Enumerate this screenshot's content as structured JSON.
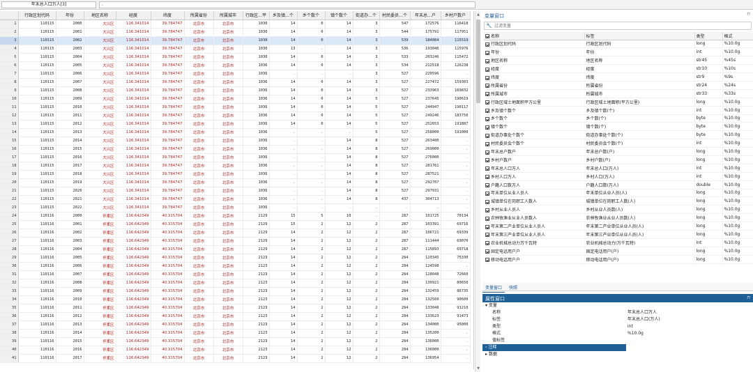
{
  "topbar": {
    "cell_ref": "年末总人口万人[3]",
    "cell_value": "."
  },
  "grid": {
    "columns": [
      "",
      "行政区划代码",
      "年份",
      "地区名称",
      "经度",
      "纬度",
      "所属省份",
      "所属城市",
      "行政区…平",
      "乡及镇…个",
      "乡个数个",
      "镇个数个",
      "街道办…个",
      "村民委员…个",
      "年末总…户",
      "乡村户数户"
    ],
    "rows": [
      [
        "1",
        "110115",
        "2000",
        "大兴区",
        "116.341014",
        "39.784747",
        "北京市",
        "北京市",
        "1030",
        "14",
        "0",
        "14",
        "3",
        "547",
        "172576",
        "116418"
      ],
      [
        "2",
        "110115",
        "2001",
        "大兴区",
        "116.341014",
        "39.784747",
        "北京市",
        "北京市",
        "1030",
        "14",
        "0",
        "14",
        "3",
        "544",
        "175791",
        "117951"
      ],
      [
        "3",
        "110115",
        "2002",
        "大兴区",
        "116.341014",
        "39.784747",
        "北京市",
        "北京市",
        "1030",
        "14",
        "0",
        "14",
        "3",
        "539",
        "184084",
        "115519"
      ],
      [
        "4",
        "110115",
        "2003",
        "大兴区",
        "116.341014",
        "39.784747",
        "北京市",
        "北京市",
        "1030",
        "13",
        ".",
        "14",
        "3",
        "536",
        "193040",
        "115976"
      ],
      [
        "5",
        "110115",
        "2004",
        "大兴区",
        "116.341014",
        "39.784747",
        "北京市",
        "北京市",
        "1030",
        "14",
        "0",
        "14",
        "3",
        "533",
        "203246",
        "115472"
      ],
      [
        "6",
        "110115",
        "2005",
        "大兴区",
        "116.341014",
        "39.784747",
        "北京市",
        "北京市",
        "1036",
        "14",
        "0",
        "14",
        "3",
        "534",
        "212518",
        "126238"
      ],
      [
        "7",
        "110115",
        "2006",
        "大兴区",
        "116.341014",
        "39.784747",
        "北京市",
        "北京市",
        "1036",
        ".",
        ".",
        ".",
        "3",
        "527",
        "220596",
        "."
      ],
      [
        "8",
        "110115",
        "2007",
        "大兴区",
        "116.341014",
        "39.784747",
        "北京市",
        "北京市",
        "1036",
        "14",
        "0",
        "14",
        "3",
        "527",
        "227472",
        "159303"
      ],
      [
        "9",
        "110115",
        "2008",
        "大兴区",
        "116.341014",
        "39.784747",
        "北京市",
        "北京市",
        "1036",
        "14",
        "0",
        "14",
        "3",
        "527",
        "233963",
        "169832"
      ],
      [
        "10",
        "110115",
        "2009",
        "大兴区",
        "116.341014",
        "39.784747",
        "北京市",
        "北京市",
        "1036",
        "14",
        "0",
        "14",
        "5",
        "527",
        "237645",
        "190619"
      ],
      [
        "11",
        "110115",
        "2010",
        "大兴区",
        "116.341014",
        "39.784747",
        "北京市",
        "北京市",
        "1036",
        "14",
        "0",
        "14",
        "5",
        "527",
        "244947",
        "190117"
      ],
      [
        "12",
        "110115",
        "2011",
        "大兴区",
        "116.341014",
        "39.784747",
        "北京市",
        "北京市",
        "1036",
        "14",
        "0",
        "14",
        "5",
        "527",
        "249246",
        "183750"
      ],
      [
        "13",
        "110115",
        "2012",
        "大兴区",
        "116.341014",
        "39.784747",
        "北京市",
        "北京市",
        "1036",
        "14",
        "0",
        "14",
        "5",
        "527",
        "252653",
        "191887"
      ],
      [
        "14",
        "110115",
        "2013",
        "大兴区",
        "116.341014",
        "39.784747",
        "北京市",
        "北京市",
        "1036",
        ".",
        ".",
        ".",
        "5",
        "527",
        "258000",
        "191000"
      ],
      [
        "15",
        "110115",
        "2014",
        "大兴区",
        "116.341014",
        "39.784747",
        "北京市",
        "北京市",
        "1036",
        ".",
        ".",
        "14",
        "8",
        "527",
        "263400",
        "."
      ],
      [
        "16",
        "110115",
        "2015",
        "大兴区",
        "116.341014",
        "39.784747",
        "北京市",
        "北京市",
        "1036",
        ".",
        ".",
        "14",
        "8",
        "527",
        "269000",
        "."
      ],
      [
        "17",
        "110115",
        "2016",
        "大兴区",
        "116.341014",
        "39.784747",
        "北京市",
        "北京市",
        "1036",
        ".",
        ".",
        "14",
        "8",
        "527",
        "276000",
        "."
      ],
      [
        "18",
        "110115",
        "2017",
        "大兴区",
        "116.341014",
        "39.784747",
        "北京市",
        "北京市",
        "1036",
        ".",
        ".",
        "14",
        "8",
        "527",
        "281761",
        "."
      ],
      [
        "19",
        "110115",
        "2018",
        "大兴区",
        "116.341014",
        "39.784747",
        "北京市",
        "北京市",
        "1036",
        ".",
        ".",
        "14",
        "8",
        "527",
        "287521",
        "."
      ],
      [
        "20",
        "110115",
        "2019",
        "大兴区",
        "116.341014",
        "39.784747",
        "北京市",
        "北京市",
        "1036",
        ".",
        ".",
        "14",
        "8",
        "527",
        "292707",
        "."
      ],
      [
        "21",
        "110115",
        "2020",
        "大兴区",
        "116.341014",
        "39.784747",
        "北京市",
        "北京市",
        "1036",
        ".",
        ".",
        "14",
        "8",
        "527",
        "297931",
        "."
      ],
      [
        "22",
        "110115",
        "2021",
        "大兴区",
        "116.341014",
        "39.784747",
        "北京市",
        "北京市",
        "1036",
        ".",
        ".",
        "14",
        "8",
        "437",
        "304713",
        "."
      ],
      [
        "23",
        "110115",
        "2022",
        "大兴区",
        "116.341014",
        "39.784747",
        "北京市",
        "北京市",
        "1036",
        ".",
        ".",
        ".",
        ".",
        ".",
        ".",
        "."
      ],
      [
        "24",
        "110116",
        "2000",
        "怀柔区",
        "116.642349",
        "40.315704",
        "北京市",
        "北京市",
        "2129",
        "15",
        "5",
        "10",
        ".",
        "287",
        "101725",
        "70134"
      ],
      [
        "25",
        "110116",
        "2001",
        "怀柔区",
        "116.642349",
        "40.315704",
        "北京市",
        "北京市",
        "2129",
        "15",
        "2",
        "12",
        "2",
        "287",
        "103391",
        "69716"
      ],
      [
        "26",
        "110116",
        "2002",
        "怀柔区",
        "116.642349",
        "40.315704",
        "北京市",
        "北京市",
        "2129",
        "14",
        "2",
        "12",
        "2",
        "287",
        "106721",
        "69339"
      ],
      [
        "27",
        "110116",
        "2003",
        "怀柔区",
        "116.642349",
        "40.315704",
        "北京市",
        "北京市",
        "2129",
        "14",
        "2",
        "12",
        "2",
        "287",
        "111444",
        "69070"
      ],
      [
        "28",
        "110116",
        "2004",
        "怀柔区",
        "116.642349",
        "40.315704",
        "北京市",
        "北京市",
        "2129",
        "14",
        "2",
        "12",
        "2",
        "287",
        "115893",
        "69718"
      ],
      [
        "29",
        "110116",
        "2005",
        "怀柔区",
        "116.642349",
        "40.315704",
        "北京市",
        "北京市",
        "2123",
        "14",
        "2",
        "12",
        "2",
        "284",
        "120345",
        "75330"
      ],
      [
        "30",
        "110116",
        "2006",
        "怀柔区",
        "116.642349",
        "40.315704",
        "北京市",
        "北京市",
        "2123",
        "14",
        "2",
        "12",
        "2",
        "284",
        "124598",
        "."
      ],
      [
        "31",
        "110116",
        "2007",
        "怀柔区",
        "116.642349",
        "40.315704",
        "北京市",
        "北京市",
        "2123",
        "14",
        "2",
        "12",
        "2",
        "284",
        "128048",
        "72660"
      ],
      [
        "32",
        "110116",
        "2008",
        "怀柔区",
        "116.642349",
        "40.315704",
        "北京市",
        "北京市",
        "2123",
        "14",
        "2",
        "12",
        "2",
        "284",
        "130921",
        "80650"
      ],
      [
        "33",
        "110116",
        "2009",
        "怀柔区",
        "116.642349",
        "40.315704",
        "北京市",
        "北京市",
        "2123",
        "14",
        "2",
        "12",
        "2",
        "284",
        "132459",
        "86735"
      ],
      [
        "34",
        "110116",
        "2010",
        "怀柔区",
        "116.642349",
        "40.315704",
        "北京市",
        "北京市",
        "2123",
        "14",
        "2",
        "12",
        "2",
        "284",
        "132560",
        "90600"
      ],
      [
        "35",
        "110116",
        "2011",
        "怀柔区",
        "116.642349",
        "40.315704",
        "北京市",
        "北京市",
        "2123",
        "14",
        "2",
        "12",
        "2",
        "284",
        "133048",
        "91210"
      ],
      [
        "36",
        "110116",
        "2012",
        "怀柔区",
        "116.642349",
        "40.315704",
        "北京市",
        "北京市",
        "2123",
        "14",
        "2",
        "12",
        "2",
        "284",
        "133623",
        "91473"
      ],
      [
        "37",
        "110116",
        "2013",
        "怀柔区",
        "116.642349",
        "40.315704",
        "北京市",
        "北京市",
        "2123",
        "14",
        "2",
        "12",
        "2",
        "284",
        "134000",
        "95000"
      ],
      [
        "38",
        "110116",
        "2014",
        "怀柔区",
        "116.642349",
        "40.315704",
        "北京市",
        "北京市",
        "2123",
        "14",
        "2",
        "12",
        "2",
        "284",
        "135200",
        "."
      ],
      [
        "39",
        "110116",
        "2015",
        "怀柔区",
        "116.642349",
        "40.315704",
        "北京市",
        "北京市",
        "2123",
        "14",
        "2",
        "12",
        "2",
        "284",
        "136000",
        "."
      ],
      [
        "40",
        "110116",
        "2016",
        "怀柔区",
        "116.642349",
        "40.315704",
        "北京市",
        "北京市",
        "2123",
        "14",
        "2",
        "12",
        "2",
        "284",
        "136000",
        "."
      ],
      [
        "41",
        "110116",
        "2017",
        "怀柔区",
        "116.642349",
        "40.315704",
        "北京市",
        "北京市",
        "2123",
        "14",
        "2",
        "12",
        "2",
        "284",
        "136954",
        "."
      ]
    ]
  },
  "variables_panel": {
    "title": "变量窗口",
    "filter_placeholder": "过滤变量",
    "headers": [
      "名称",
      "标签",
      "类型",
      "格式"
    ],
    "items": [
      [
        "行政区划代码",
        "行政区划代码",
        "long",
        "%10.0g"
      ],
      [
        "年份",
        "年份",
        "int",
        "%10.0g"
      ],
      [
        "地区名称",
        "地区名称",
        "str45",
        "%45s"
      ],
      [
        "经度",
        "经度",
        "str10",
        "%10s"
      ],
      [
        "纬度",
        "纬度",
        "str9",
        "%9s"
      ],
      [
        "所属省份",
        "所属省份",
        "str24",
        "%24s"
      ],
      [
        "所属城市",
        "所属城市",
        "str33",
        "%33s"
      ],
      [
        "行政区域土地面积平方公里",
        "行政区域土地面积(平方公里)",
        "long",
        "%10.0g"
      ],
      [
        "乡及镇个数个",
        "乡及镇个数(个)",
        "int",
        "%10.0g"
      ],
      [
        "乡个数个",
        "乡个数(个)",
        "byte",
        "%10.0g"
      ],
      [
        "镇个数个",
        "镇个数(个)",
        "byte",
        "%10.0g"
      ],
      [
        "街道办事处个数个",
        "街道办事处个数(个)",
        "byte",
        "%10.0g"
      ],
      [
        "村民委员会个数个",
        "村民委员会个数(个)",
        "int",
        "%10.0g"
      ],
      [
        "年末总户数户",
        "年末总户数(户)",
        "long",
        "%10.0g"
      ],
      [
        "乡村户数户",
        "乡村户数(户)",
        "long",
        "%10.0g"
      ],
      [
        "年末总人口万人",
        "年末总人口(万人)",
        "int",
        "%10.0g"
      ],
      [
        "乡村人口万人",
        "乡村人口(万人)",
        "int",
        "%10.0g"
      ],
      [
        "户籍人口数万人",
        "户籍人口数(万人)",
        "double",
        "%10.0g"
      ],
      [
        "年末单位从业人员人",
        "年末单位从业人员(人)",
        "long",
        "%10.0g"
      ],
      [
        "城镇单位在岗职工人数人",
        "城镇单位在岗职工人数(人)",
        "long",
        "%10.0g"
      ],
      [
        "乡村从业人员人",
        "乡村从业人员数(人)",
        "long",
        "%10.0g"
      ],
      [
        "农林牧渔业从业人员数人",
        "农林牧渔业从业人员数(人)",
        "long",
        "%10.0g"
      ],
      [
        "年末第二产业单位从业人员人",
        "年末第二产业单位从业人员(人)",
        "long",
        "%10.0g"
      ],
      [
        "年末第三产业单位从业人员人",
        "年末第三产业单位从业人员(人)",
        "long",
        "%10.0g"
      ],
      [
        "农业机械总动力万千瓦特",
        "农业机械总动力(万千瓦特)",
        "int",
        "%10.0g"
      ],
      [
        "固定电话用户户",
        "固定电话用户(户)",
        "long",
        "%10.0g"
      ],
      [
        "移动电话用户户",
        "移动电话用户(户)",
        "long",
        "%10.0g"
      ]
    ]
  },
  "tabs": [
    "变量窗口",
    "快照"
  ],
  "properties_panel": {
    "title": "属性窗口",
    "group_variables": "变量",
    "rows": [
      [
        "名称",
        "年末总人口万人"
      ],
      [
        "标签",
        "年末总人口(万人)"
      ],
      [
        "类型",
        "int"
      ],
      [
        "格式",
        "%10.0g"
      ],
      [
        "值标签",
        ""
      ]
    ],
    "note_label": "注释",
    "group_data": "数据"
  },
  "colors": {
    "accent": "#1e5f96",
    "string_text": "#b31b1b"
  }
}
